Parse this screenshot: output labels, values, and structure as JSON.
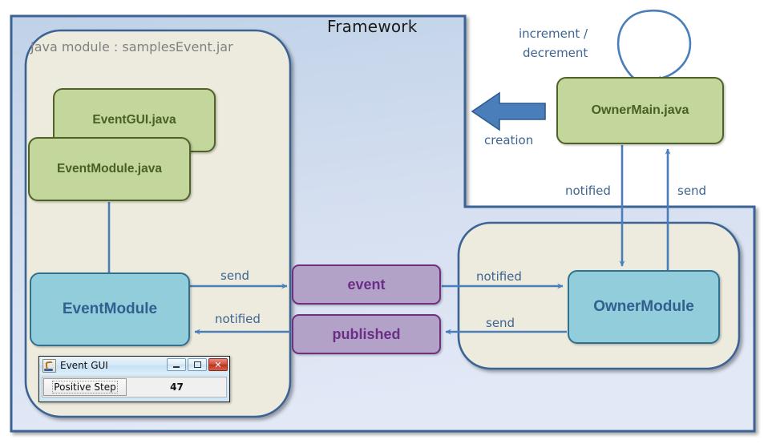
{
  "diagram": {
    "framework_panel": {
      "title": "Framework",
      "fill_top": "#c3d4e9",
      "fill_bottom": "#dfe6f4",
      "border": "#3a6494"
    },
    "java_module_panel": {
      "label": "Java module : samplesEvent.jar",
      "fill": "#edebdd",
      "border": "#3a6494"
    },
    "owner_module_panel": {
      "fill": "#edebdd",
      "border": "#3a6494"
    },
    "nodes": [
      {
        "id": "eventgui",
        "label": "EventGUI.java",
        "kind": "green"
      },
      {
        "id": "eventmodule_java",
        "label": "EventModule.java",
        "kind": "green"
      },
      {
        "id": "ownermain",
        "label": "OwnerMain.java",
        "kind": "green"
      },
      {
        "id": "eventmodule",
        "label": "EventModule",
        "kind": "blue"
      },
      {
        "id": "ownermodule",
        "label": "OwnerModule",
        "kind": "blue"
      },
      {
        "id": "event",
        "label": "event",
        "kind": "purple"
      },
      {
        "id": "published",
        "label": "published",
        "kind": "purple"
      }
    ],
    "edge_labels": {
      "increment_decrement_line1": "increment /",
      "increment_decrement_line2": "decrement",
      "creation": "creation",
      "notified_ownermain": "notified",
      "send_ownermain": "send",
      "send_eventmodule": "send",
      "notified_eventmodule": "notified",
      "notified_ownermodule": "notified",
      "send_ownermodule": "send"
    },
    "colors": {
      "green_fill": "#c3d69b",
      "green_border": "#4f6228",
      "green_text": "#4a5f23",
      "blue_fill": "#92cddc",
      "blue_border": "#31708f",
      "blue_text": "#31608f",
      "purple_fill": "#b3a2c7",
      "purple_border": "#70307f",
      "purple_text": "#6b2d86",
      "arrow": "#4a7ebb",
      "edge_label_text": "#3d6492"
    }
  },
  "java_window": {
    "title": "Event GUI",
    "icon": "java-coffee-cup-icon",
    "buttons": {
      "minimize": "minimize",
      "maximize": "maximize",
      "close": "✕"
    },
    "step_button_label": "Positive Step",
    "value": "47"
  }
}
